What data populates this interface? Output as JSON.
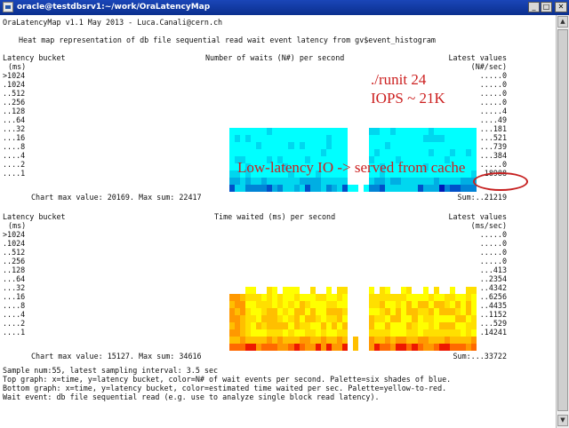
{
  "window": {
    "title": "oracle@testdbsrv1:~/work/OraLatencyMap",
    "buttons": {
      "minimize": "_",
      "maximize": "□",
      "close": "✕"
    }
  },
  "header": {
    "version_line": "OraLatencyMap v1.1 May 2013 - Luca.Canali@cern.ch",
    "description": "Heat map representation of db file sequential read wait event latency from gv$event_histogram"
  },
  "top_graph": {
    "left_header": "Latency bucket",
    "left_units": "(ms)",
    "center_header": "Number of waits (N#) per second",
    "right_header": "Latest values",
    "right_units": "(N#/sec)",
    "rows": [
      {
        "label": ">1024",
        "value": ".....0"
      },
      {
        "label": ".1024",
        "value": ".....0"
      },
      {
        "label": "..512",
        "value": ".....0"
      },
      {
        "label": "..256",
        "value": ".....0"
      },
      {
        "label": "..128",
        "value": ".....4"
      },
      {
        "label": "...64",
        "value": "....49"
      },
      {
        "label": "...32",
        "value": "...181"
      },
      {
        "label": "...16",
        "value": "...521"
      },
      {
        "label": "....8",
        "value": "...739"
      },
      {
        "label": "....4",
        "value": "...384"
      },
      {
        "label": "....2",
        "value": ".....0"
      },
      {
        "label": "....1",
        "value": ".18988"
      }
    ],
    "footer_left": "Chart max value: 20169. Max sum: 22417",
    "footer_right": "Sum:..21219",
    "palette": [
      "#00ffff",
      "#00d7ef",
      "#00aee3",
      "#0084d6",
      "#0050c9",
      "#0018b7"
    ]
  },
  "bottom_graph": {
    "left_header": "Latency bucket",
    "left_units": "(ms)",
    "center_header": "Time waited (ms) per second",
    "right_header": "Latest values",
    "right_units": "(ms/sec)",
    "rows": [
      {
        "label": ">1024",
        "value": ".....0"
      },
      {
        "label": ".1024",
        "value": ".....0"
      },
      {
        "label": "..512",
        "value": ".....0"
      },
      {
        "label": "..256",
        "value": ".....0"
      },
      {
        "label": "..128",
        "value": "...413"
      },
      {
        "label": "...64",
        "value": "..2354"
      },
      {
        "label": "...32",
        "value": "..4342"
      },
      {
        "label": "...16",
        "value": "..6256"
      },
      {
        "label": "....8",
        "value": "..4435"
      },
      {
        "label": "....4",
        "value": "..1152"
      },
      {
        "label": "....2",
        "value": "...529"
      },
      {
        "label": "....1",
        "value": ".14241"
      }
    ],
    "footer_left": "Chart max value: 15127. Max sum: 34616",
    "footer_right": "Sum:...33722",
    "palette": [
      "#ffff00",
      "#ffdf00",
      "#ffbf00",
      "#ff9800",
      "#ff6a00",
      "#ee1800"
    ]
  },
  "info": {
    "line1": "Sample num:55, latest sampling interval: 3.5 sec",
    "line2": "Top graph: x=time, y=latency bucket, color=N# of wait events per second. Palette=six shades of blue.",
    "line3": "Bottom graph: x=time, y=latency bucket, color=estimated time waited per sec. Palette=yellow-to-red.",
    "line4": "Wait event: db file sequential read (e.g. use to analyze single block read latency)."
  },
  "annotations": {
    "runit": "./runit 24",
    "iops": "IOPS ~ 21K",
    "cache": "Low-latency IO -> served from cache"
  },
  "scrollbar": {
    "up": "▲",
    "down": "▼"
  }
}
